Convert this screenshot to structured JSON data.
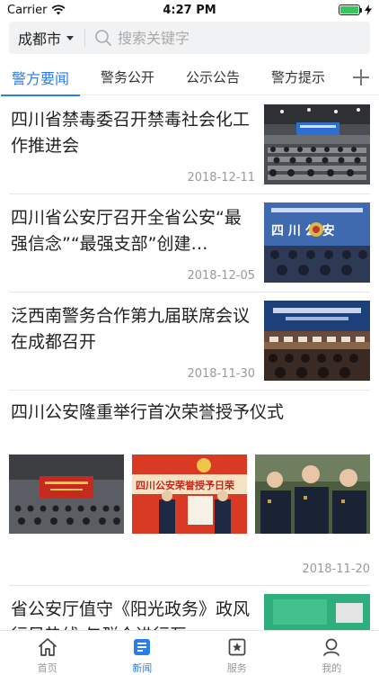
{
  "status_bar": {
    "carrier": "Carrier",
    "time": "4:27 PM",
    "battery_level": 1.0
  },
  "search": {
    "city": "成都市",
    "placeholder": "搜索关键字"
  },
  "tabs": [
    {
      "label": "警方要闻",
      "active": true
    },
    {
      "label": "警务公开",
      "active": false
    },
    {
      "label": "公示公告",
      "active": false
    },
    {
      "label": "警方提示",
      "active": false
    }
  ],
  "news": [
    {
      "title": "四川省禁毒委召开禁毒社会化工作推进会",
      "date": "2018-12-11"
    },
    {
      "title": "四川省公安厅召开全省公安“最强信念”“最强支部”创建…",
      "date": "2018-12-05",
      "image_text": "四 川 公 安"
    },
    {
      "title": "泛西南警务合作第九届联席会议在成都召开",
      "date": "2018-11-30"
    },
    {
      "title": "四川公安隆重举行首次荣誉授予仪式",
      "date": "2018-11-20",
      "image_text": "四川公安荣誉授予日荣"
    },
    {
      "title": "省公安厅值守《阳光政务》政风行风热线 与群众进行互…",
      "date": ""
    }
  ],
  "tab_bar": [
    {
      "label": "首页",
      "icon": "home-icon",
      "active": false
    },
    {
      "label": "新闻",
      "icon": "news-icon",
      "active": true
    },
    {
      "label": "服务",
      "icon": "star-box-icon",
      "active": false
    },
    {
      "label": "我的",
      "icon": "profile-icon",
      "active": false
    }
  ],
  "colors": {
    "accent": "#2a7ee8",
    "battery": "#34c759"
  }
}
